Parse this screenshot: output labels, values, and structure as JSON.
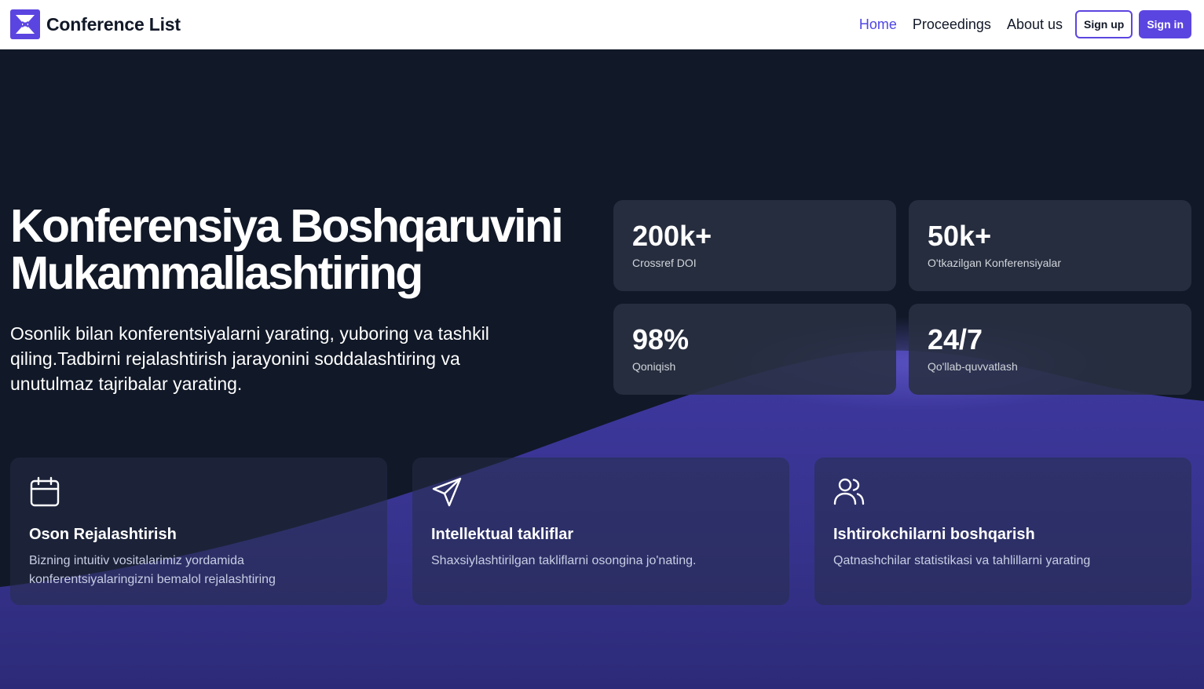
{
  "brand": {
    "name": "Conference List",
    "logo_icon": "logo-icon"
  },
  "nav": {
    "links": [
      {
        "label": "Home",
        "active": true
      },
      {
        "label": "Proceedings",
        "active": false
      },
      {
        "label": "About us",
        "active": false
      }
    ],
    "signup_label": "Sign up",
    "signin_label": "Sign in"
  },
  "hero": {
    "title_line1": "Konferensiya Boshqaruvini",
    "title_line2": "Mukammallashtiring",
    "subtitle": "Osonlik bilan konferentsiyalarni yarating, yuboring va tashkil qiling.Tadbirni rejalashtirish jarayonini soddalashtiring va unutulmaz tajribalar yarating."
  },
  "stats": [
    {
      "value": "200k+",
      "label": "Crossref DOI"
    },
    {
      "value": "50k+",
      "label": "O'tkazilgan Konferensiyalar"
    },
    {
      "value": "98%",
      "label": "Qoniqish"
    },
    {
      "value": "24/7",
      "label": "Qo'llab-quvvatlash"
    }
  ],
  "features": [
    {
      "icon": "calendar-icon",
      "title": "Oson Rejalashtirish",
      "desc": "Bizning intuitiv vositalarimiz yordamida konferentsiyalaringizni bemalol rejalashtiring"
    },
    {
      "icon": "send-icon",
      "title": "Intellektual takliflar",
      "desc": "Shaxsiylashtirilgan takliflarni osongina jo'nating."
    },
    {
      "icon": "users-icon",
      "title": "Ishtirokchilarni boshqarish",
      "desc": "Qatnashchilar statistikasi va tahlillarni yarating"
    }
  ],
  "colors": {
    "accent": "#5b45e0",
    "active_link": "#4f46e5",
    "hero_dark": "#111827",
    "wave": "#3b3694"
  }
}
